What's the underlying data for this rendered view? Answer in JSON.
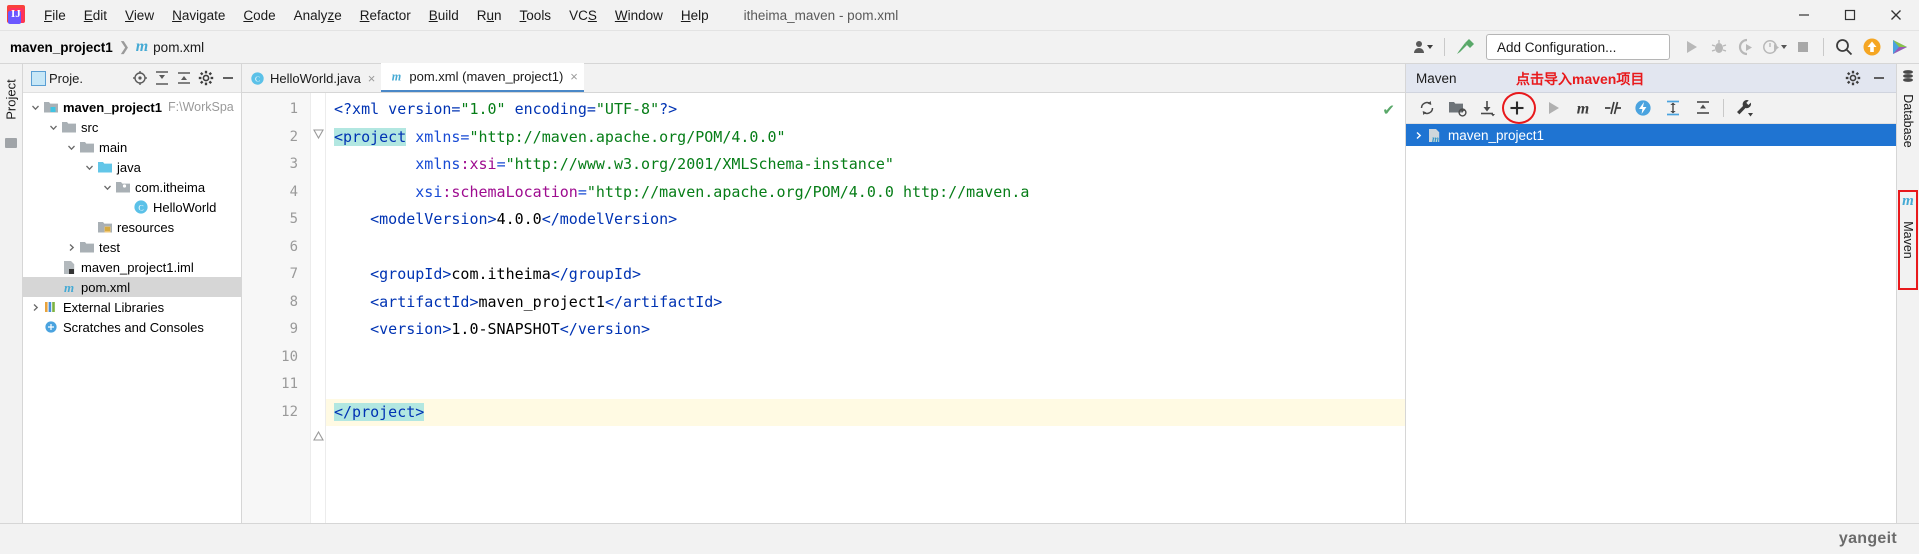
{
  "window": {
    "title": "itheima_maven - pom.xml",
    "minimize_label": "minimize-window",
    "maximize_label": "maximize-window",
    "close_label": "close-window"
  },
  "menubar": {
    "items": [
      {
        "label": "File",
        "mnemonic": "F"
      },
      {
        "label": "Edit",
        "mnemonic": "E"
      },
      {
        "label": "View",
        "mnemonic": "V"
      },
      {
        "label": "Navigate",
        "mnemonic": "N"
      },
      {
        "label": "Code",
        "mnemonic": "C"
      },
      {
        "label": "Analyze",
        "mnemonic": "z"
      },
      {
        "label": "Refactor",
        "mnemonic": "R"
      },
      {
        "label": "Build",
        "mnemonic": "B"
      },
      {
        "label": "Run",
        "mnemonic": "u"
      },
      {
        "label": "Tools",
        "mnemonic": "T"
      },
      {
        "label": "VCS",
        "mnemonic": "S"
      },
      {
        "label": "Window",
        "mnemonic": "W"
      },
      {
        "label": "Help",
        "mnemonic": "H"
      }
    ]
  },
  "navbar": {
    "breadcrumb_project": "maven_project1",
    "breadcrumb_separator": "❯",
    "breadcrumb_file_badge": "m",
    "breadcrumb_file": "pom.xml",
    "add_configuration": "Add Configuration...",
    "icons": [
      "user-dropdown-icon",
      "hammer-build-icon",
      "run-icon",
      "debug-icon",
      "run-coverage-icon",
      "profile-icon",
      "stop-icon",
      "search-icon",
      "update-project-icon",
      "ide-assistant-icon"
    ]
  },
  "project_tool_window": {
    "vertical_tab": "Project",
    "title": "Proje.",
    "header_icons": [
      "locate-icon",
      "expand-all-icon",
      "collapse-all-icon",
      "gear-icon",
      "hide-icon"
    ],
    "tree": [
      {
        "label": "maven_project1",
        "path": "F:\\WorkSpa",
        "depth": 0,
        "arrow": "down",
        "icon": "module-folder-icon",
        "bold": true,
        "selected": false
      },
      {
        "label": "src",
        "path": "",
        "depth": 1,
        "arrow": "down",
        "icon": "folder-icon",
        "bold": false,
        "selected": false
      },
      {
        "label": "main",
        "path": "",
        "depth": 2,
        "arrow": "down",
        "icon": "folder-icon",
        "bold": false,
        "selected": false
      },
      {
        "label": "java",
        "path": "",
        "depth": 3,
        "arrow": "down",
        "icon": "source-folder-icon",
        "bold": false,
        "selected": false
      },
      {
        "label": "com.itheima",
        "path": "",
        "depth": 4,
        "arrow": "down",
        "icon": "package-icon",
        "bold": false,
        "selected": false
      },
      {
        "label": "HelloWorld",
        "path": "",
        "depth": 5,
        "arrow": "none",
        "icon": "java-class-icon",
        "bold": false,
        "selected": false
      },
      {
        "label": "resources",
        "path": "",
        "depth": 3,
        "arrow": "none",
        "icon": "resources-folder-icon",
        "bold": false,
        "selected": false
      },
      {
        "label": "test",
        "path": "",
        "depth": 2,
        "arrow": "right",
        "icon": "folder-icon",
        "bold": false,
        "selected": false
      },
      {
        "label": "maven_project1.iml",
        "path": "",
        "depth": 2,
        "arrow": "none",
        "icon": "iml-file-icon",
        "bold": false,
        "selected": false
      },
      {
        "label": "pom.xml",
        "path": "",
        "depth": 2,
        "arrow": "none",
        "icon": "maven-pom-icon",
        "bold": false,
        "selected": true
      },
      {
        "label": "External Libraries",
        "path": "",
        "depth": 0,
        "arrow": "right",
        "icon": "libraries-icon",
        "bold": false,
        "selected": false
      },
      {
        "label": "Scratches and Consoles",
        "path": "",
        "depth": 0,
        "arrow": "none",
        "icon": "scratches-icon",
        "bold": false,
        "selected": false
      }
    ]
  },
  "editor": {
    "tabs": [
      {
        "label": "HelloWorld.java",
        "icon": "java-class-icon",
        "active": false,
        "close": "×"
      },
      {
        "label": "pom.xml (maven_project1)",
        "icon": "maven-pom-icon",
        "active": true,
        "close": "×"
      }
    ],
    "inspection_status": "✔",
    "lines": [
      {
        "num": "1",
        "highlight": false,
        "fold": "none",
        "tokens": [
          {
            "t": "<?xml version=",
            "c": "pi"
          },
          {
            "t": "\"1.0\"",
            "c": "str"
          },
          {
            "t": " encoding=",
            "c": "pi"
          },
          {
            "t": "\"UTF-8\"",
            "c": "str"
          },
          {
            "t": "?>",
            "c": "pi"
          }
        ]
      },
      {
        "num": "2",
        "highlight": false,
        "fold": "open",
        "tokens": [
          {
            "t": "<project",
            "c": "tag2"
          },
          {
            "t": " xmlns=",
            "c": "attr"
          },
          {
            "t": "\"http://maven.apache.org/POM/4.0.0\"",
            "c": "str"
          }
        ]
      },
      {
        "num": "3",
        "highlight": false,
        "fold": "none",
        "tokens": [
          {
            "t": "         xmlns",
            "c": "attr"
          },
          {
            "t": ":xsi",
            "c": "ns"
          },
          {
            "t": "=",
            "c": "attr"
          },
          {
            "t": "\"http://www.w3.org/2001/XMLSchema-instance\"",
            "c": "str"
          }
        ]
      },
      {
        "num": "4",
        "highlight": false,
        "fold": "none",
        "tokens": [
          {
            "t": "         xsi",
            "c": "attr"
          },
          {
            "t": ":schemaLocation",
            "c": "ns"
          },
          {
            "t": "=",
            "c": "attr"
          },
          {
            "t": "\"http://maven.apache.org/POM/4.0.0 http://maven.a",
            "c": "str"
          }
        ]
      },
      {
        "num": "5",
        "highlight": false,
        "fold": "none",
        "tokens": [
          {
            "t": "    <modelVersion>",
            "c": "tag"
          },
          {
            "t": "4.0.0",
            "c": "txt"
          },
          {
            "t": "</modelVersion>",
            "c": "tag"
          }
        ]
      },
      {
        "num": "6",
        "highlight": false,
        "fold": "none",
        "tokens": []
      },
      {
        "num": "7",
        "highlight": false,
        "fold": "none",
        "tokens": [
          {
            "t": "    <groupId>",
            "c": "tag"
          },
          {
            "t": "com.itheima",
            "c": "txt"
          },
          {
            "t": "</groupId>",
            "c": "tag"
          }
        ]
      },
      {
        "num": "8",
        "highlight": false,
        "fold": "none",
        "tokens": [
          {
            "t": "    <artifactId>",
            "c": "tag"
          },
          {
            "t": "maven_project1",
            "c": "txt"
          },
          {
            "t": "</artifactId>",
            "c": "tag"
          }
        ]
      },
      {
        "num": "9",
        "highlight": false,
        "fold": "none",
        "tokens": [
          {
            "t": "    <version>",
            "c": "tag"
          },
          {
            "t": "1.0-SNAPSHOT",
            "c": "txt"
          },
          {
            "t": "</version>",
            "c": "tag"
          }
        ]
      },
      {
        "num": "10",
        "highlight": false,
        "fold": "none",
        "tokens": []
      },
      {
        "num": "11",
        "highlight": false,
        "fold": "none",
        "tokens": []
      },
      {
        "num": "12",
        "highlight": true,
        "fold": "close",
        "tokens": [
          {
            "t": "</project>",
            "c": "tag2"
          }
        ]
      }
    ]
  },
  "maven_tool_window": {
    "title": "Maven",
    "annotation": "点击导入maven项目",
    "header_icons": [
      "gear-icon",
      "hide-icon"
    ],
    "toolbar_icons": [
      "reload-all-icon",
      "add-managed-files-icon",
      "download-sources-icon",
      "add-maven-project-icon",
      "run-icon",
      "execute-goal-icon",
      "toggle-skip-tests-icon",
      "toggle-offline-icon",
      "expand-all-icon",
      "collapse-all-icon",
      "settings-wrench-icon"
    ],
    "highlighted_tool": "add-maven-project-icon",
    "tree": [
      {
        "label": "maven_project1",
        "arrow": "right",
        "icon": "maven-project-icon",
        "selected": true
      }
    ]
  },
  "right_strip": {
    "database_label": "Database",
    "maven_label": "Maven",
    "maven_badge": "m"
  },
  "statusbar": {
    "watermark": "yangeit"
  },
  "colors": {
    "accent_blue": "#1f74d2",
    "annotation_red": "#e8191c",
    "string_green": "#067d17",
    "tag_blue": "#0033b3",
    "maven_header_bg": "#e2e6f0",
    "selection_gray": "#d6d6d6",
    "highlight_yellow": "#fffae3"
  }
}
